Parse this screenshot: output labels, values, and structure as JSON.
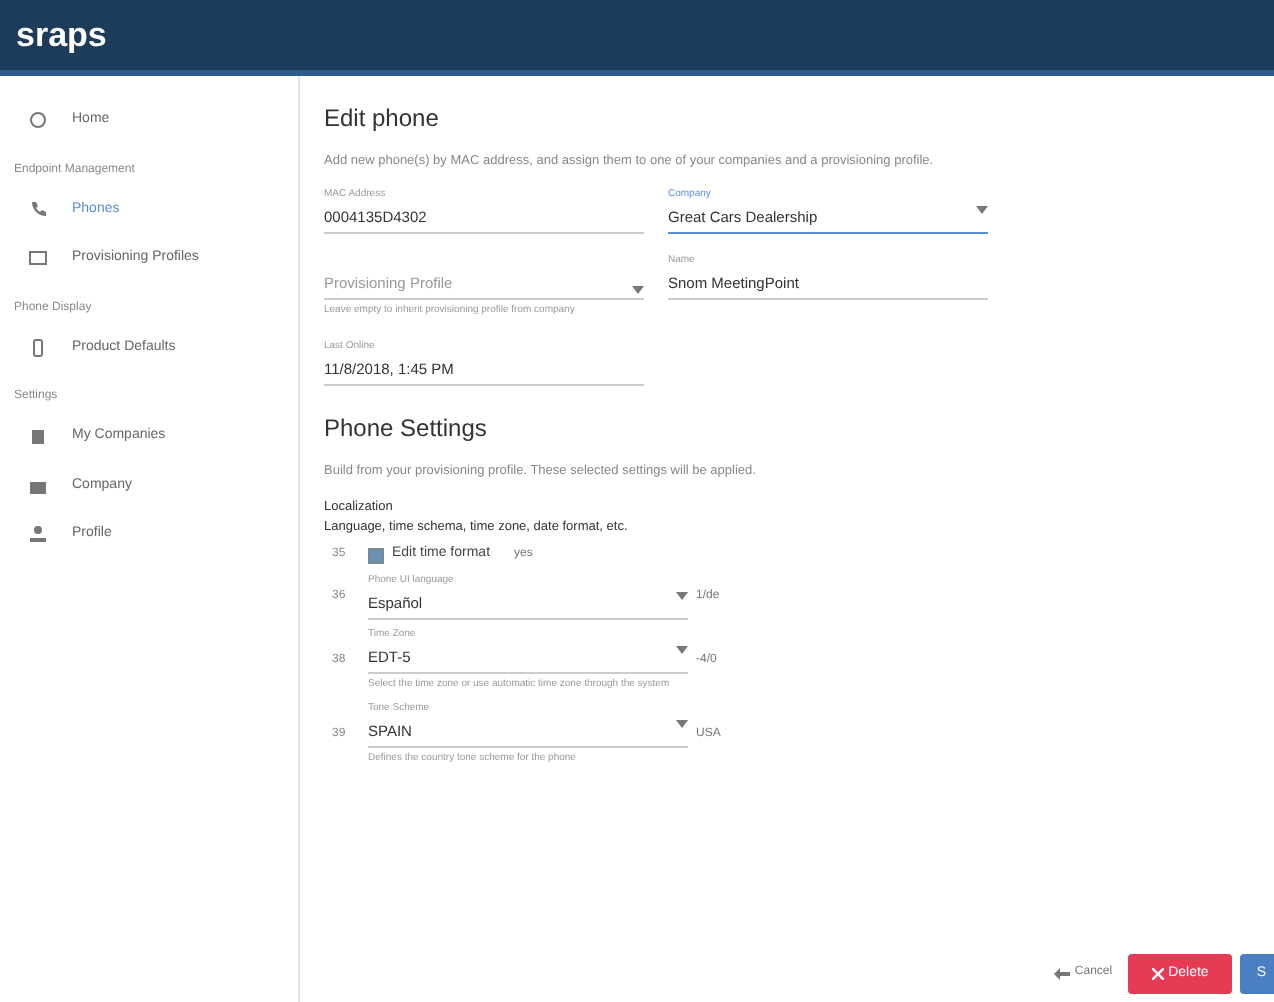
{
  "brand": "sraps",
  "sidebar": {
    "items": [
      {
        "kind": "link",
        "label": "Home",
        "selected": false
      },
      {
        "kind": "section",
        "label": "Endpoint Management"
      },
      {
        "kind": "link",
        "label": "Phones",
        "selected": true
      },
      {
        "kind": "link",
        "label": "Provisioning Profiles",
        "selected": false
      },
      {
        "kind": "section",
        "label": "Phone Display"
      },
      {
        "kind": "link",
        "label": "Product Defaults",
        "selected": false
      },
      {
        "kind": "section",
        "label": "Settings"
      },
      {
        "kind": "link",
        "label": "My Companies",
        "selected": false
      },
      {
        "kind": "link",
        "label": "Company",
        "selected": false
      },
      {
        "kind": "link",
        "label": "Profile",
        "selected": false
      }
    ]
  },
  "form": {
    "title": "Edit phone",
    "description": "Add new phone(s) by MAC address, and assign them to one of your companies and a provisioning profile.",
    "rows": [
      {
        "fields": [
          {
            "kind": "text",
            "label": "MAC Address",
            "value": "0004135D4302",
            "focused": false
          },
          {
            "kind": "select",
            "label": "Company",
            "value": "Great Cars Dealership",
            "focused": true
          }
        ]
      },
      {
        "fields": [
          {
            "kind": "select",
            "placeholder": "Provisioning Profile",
            "helper": "Leave empty to inherit provisioning profile from company",
            "focused": false
          },
          {
            "kind": "text",
            "label": "Name",
            "value": "Snom MeetingPoint",
            "focused": false
          }
        ]
      },
      {
        "fields": [
          {
            "kind": "text",
            "label": "Last Online",
            "value": "11/8/2018, 1:45 PM",
            "focused": false
          }
        ]
      }
    ]
  },
  "settings": {
    "title": "Phone Settings",
    "description": "Build from your provisioning profile. These selected settings will be applied.",
    "group": {
      "title": "Localization",
      "subtitle": "Language, time schema, time zone, date format, etc."
    },
    "rows": [
      {
        "kind": "checkbox",
        "number": "35",
        "label": "Edit time format",
        "checked": true,
        "value": "yes"
      },
      {
        "kind": "select",
        "number": "36",
        "label": "Phone UI language",
        "value": "Español",
        "note": "1/de"
      },
      {
        "kind": "select",
        "number": "38",
        "label": "Time Zone",
        "value": "EDT-5",
        "note": "-4/0",
        "helper": "Select the time zone or use automatic time zone through the system"
      },
      {
        "kind": "select",
        "number": "39",
        "label": "Tone Scheme",
        "value": "SPAIN",
        "note": "USA",
        "helper": "Defines the country tone scheme for the phone"
      }
    ]
  },
  "footer": {
    "cancel": "Cancel",
    "delete": "Delete",
    "save": "S"
  }
}
